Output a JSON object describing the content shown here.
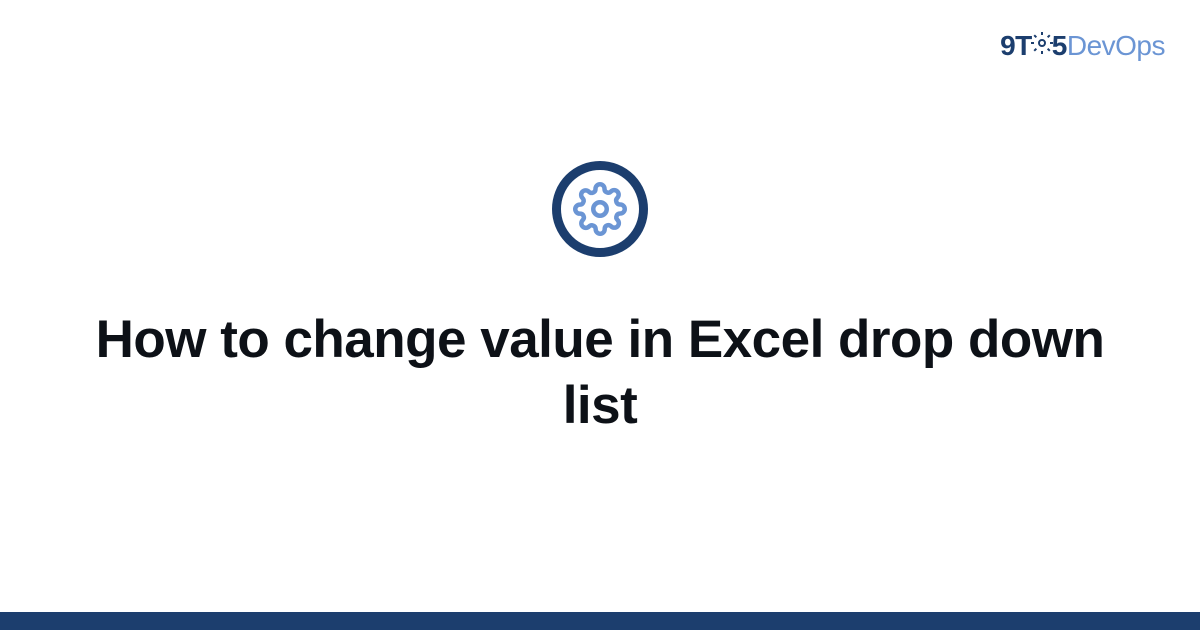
{
  "brand": {
    "part1": "9T",
    "part2": "5",
    "part3": "DevOps"
  },
  "title": "How to change value in Excel drop down list",
  "colors": {
    "primary": "#1c3e6e",
    "accent": "#6b95d4"
  }
}
